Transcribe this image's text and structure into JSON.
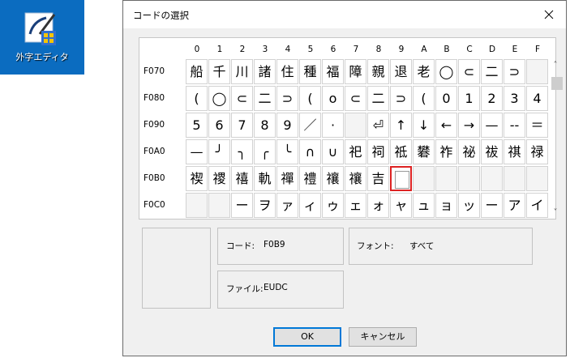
{
  "desktop": {
    "icon_label": "外字エディタ"
  },
  "dialog": {
    "title": "コードの選択",
    "columns": [
      "0",
      "1",
      "2",
      "3",
      "4",
      "5",
      "6",
      "7",
      "8",
      "9",
      "A",
      "B",
      "C",
      "D",
      "E",
      "F"
    ],
    "rows": [
      {
        "label": "F070",
        "chars": [
          "船",
          "千",
          "川",
          "諸",
          "住",
          "種",
          "福",
          "障",
          "親",
          "退",
          "老",
          "◯",
          "⊂",
          "二",
          "⊃",
          ""
        ]
      },
      {
        "label": "F080",
        "chars": [
          "(",
          "◯",
          "⊂",
          "二",
          "⊃",
          "(",
          "o",
          "⊂",
          "二",
          "⊃",
          "(",
          "0",
          "1",
          "2",
          "3",
          "4"
        ]
      },
      {
        "label": "F090",
        "chars": [
          "5",
          "6",
          "7",
          "8",
          "9",
          "／",
          "·",
          "",
          "⏎",
          "↑",
          "↓",
          "←",
          "→",
          "—",
          "--",
          "＝",
          "＿"
        ]
      },
      {
        "label": "F0A0",
        "chars": [
          "—",
          "╯",
          "╮",
          "╭",
          "╰",
          "∩",
          "∪",
          "祀",
          "祠",
          "祗",
          "礬",
          "祚",
          "祕",
          "祓",
          "祺",
          "禄"
        ]
      },
      {
        "label": "F0B0",
        "chars": [
          "禊",
          "禝",
          "禧",
          "軌",
          "禪",
          "禮",
          "禳",
          "禳",
          "吉",
          "",
          "",
          "",
          "",
          "",
          "",
          ""
        ]
      },
      {
        "label": "F0C0",
        "chars": [
          "",
          "",
          "ー",
          "ヲ",
          "ァ",
          "ィ",
          "ゥ",
          "ェ",
          "ォ",
          "ャ",
          "ュ",
          "ョ",
          "ッ",
          "ー",
          "ア",
          "イ"
        ]
      }
    ],
    "info": {
      "code_label": "コード:",
      "code_value": "F0B9",
      "font_label": "フォント:",
      "font_value": "すべて",
      "file_label": "ファイル:",
      "file_value": "EUDC"
    },
    "buttons": {
      "ok": "OK",
      "cancel": "キャンセル"
    }
  }
}
